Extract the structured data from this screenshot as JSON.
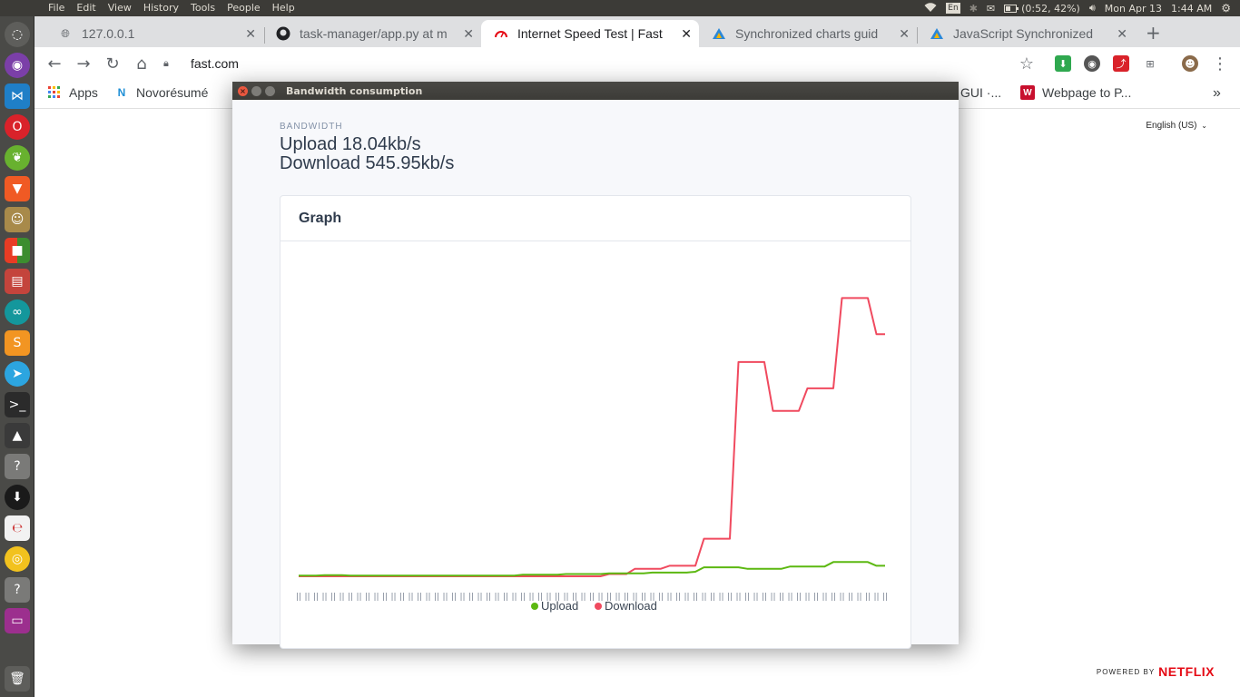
{
  "system_bar": {
    "menus": [
      "File",
      "Edit",
      "View",
      "History",
      "Tools",
      "People",
      "Help"
    ],
    "keyboard": "En",
    "battery": "(0:52, 42%)",
    "date": "Mon Apr 13",
    "time": "1:44 AM"
  },
  "launcher": {
    "icons": [
      "ubuntu-logo-icon",
      "tor-browser-icon",
      "vscode-icon",
      "opera-icon",
      "leaf-app-icon",
      "brave-icon",
      "gimp-icon",
      "windows-icon",
      "files-icon",
      "arduino-icon",
      "sublime-text-icon",
      "telegram-icon",
      "terminal-icon",
      "matlab-icon",
      "unknown-app-icon",
      "downloader-icon",
      "text-editor-icon",
      "chrome-icon",
      "unknown-app-icon",
      "video-app-icon",
      "trash-icon"
    ]
  },
  "tabs": [
    {
      "title": "127.0.0.1",
      "icon": "globe-icon",
      "active": false
    },
    {
      "title": "task-manager/app.py at m",
      "icon": "github-icon",
      "active": false
    },
    {
      "title": "Internet Speed Test | Fast",
      "icon": "fast-gauge-icon",
      "active": true
    },
    {
      "title": "Synchronized charts guid",
      "icon": "canvasjs-icon",
      "active": false
    },
    {
      "title": "JavaScript Synchronized",
      "icon": "canvasjs-icon",
      "active": false
    }
  ],
  "address_bar": {
    "url": "fast.com"
  },
  "bookmarks": [
    {
      "label": "Apps",
      "icon": "apps-grid-icon"
    },
    {
      "label": "Novorésumé",
      "icon": "novoresume-icon"
    },
    {
      "label": "GUI ·...",
      "icon": ""
    },
    {
      "label": "Webpage to P...",
      "icon": "webpage-to-pdf-icon"
    }
  ],
  "page": {
    "language": "English (US)",
    "powered_by": "POWERED BY",
    "brand": "NETFLIX"
  },
  "popup": {
    "window_title": "Bandwidth consumption",
    "section_label": "BANDWIDTH",
    "upload_text": "Upload 18.04kb/s",
    "download_text": "Download 545.95kb/s",
    "card_title": "Graph"
  },
  "colors": {
    "upload": "#5cb811",
    "download": "#f04a5f"
  },
  "chart_data": {
    "type": "line",
    "title": "",
    "xlabel": "",
    "ylabel": "",
    "x_axis_note": "dense overlapping tick labels, unreadable",
    "series": [
      {
        "name": "Upload",
        "color": "#5cb811",
        "values": [
          1,
          1,
          1,
          1.5,
          1.5,
          1.5,
          1,
          1,
          1,
          1,
          1,
          1,
          1,
          1,
          1,
          1,
          1,
          1,
          1,
          1,
          1,
          1,
          1,
          1,
          1,
          1,
          2,
          2,
          2,
          2,
          2,
          3,
          3,
          3,
          3,
          3,
          4,
          4,
          4,
          4,
          4,
          5,
          5,
          5,
          5,
          5,
          6,
          12,
          12,
          12,
          12,
          12,
          10,
          10,
          10,
          10,
          10,
          13,
          13,
          13,
          13,
          13,
          19,
          19,
          19,
          19,
          19,
          14,
          14
        ]
      },
      {
        "name": "Download",
        "color": "#f04a5f",
        "values": [
          0,
          0,
          0,
          0,
          0,
          0,
          0,
          0,
          0,
          0,
          0,
          0,
          0,
          0,
          0,
          0,
          0,
          0,
          0,
          0,
          0,
          0,
          0,
          0,
          0,
          0,
          0,
          0,
          0,
          0,
          0,
          0,
          0,
          0,
          0,
          0,
          3,
          3,
          3,
          10,
          10,
          10,
          10,
          14,
          14,
          14,
          14,
          50,
          50,
          50,
          50,
          285,
          285,
          285,
          285,
          220,
          220,
          220,
          220,
          250,
          250,
          250,
          250,
          370,
          370,
          370,
          370,
          322,
          322
        ]
      }
    ],
    "ylim": [
      0,
      420
    ],
    "grid": false,
    "legend": "bottom-center"
  }
}
